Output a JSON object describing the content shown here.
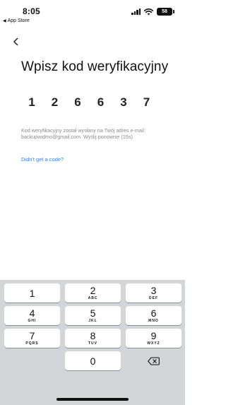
{
  "status_bar": {
    "time": "8:05",
    "back_app": "App Store",
    "battery": "58"
  },
  "header": {
    "back_icon": "chevron-left-icon"
  },
  "main": {
    "title": "Wpisz kod weryfikacyjny",
    "code_digits": [
      "1",
      "2",
      "6",
      "6",
      "3",
      "7"
    ],
    "info_line1": "Kod weryfikacyjny został wysłany na Twój adres e-mail:",
    "email": "backupwidmo@gmail.com",
    "resend_text": "Wyślij ponownie (15s)",
    "didnt_get_code": "Didn't get a code?"
  },
  "keypad": {
    "keys": [
      {
        "num": "1",
        "letters": ""
      },
      {
        "num": "2",
        "letters": "ABC"
      },
      {
        "num": "3",
        "letters": "DEF"
      },
      {
        "num": "4",
        "letters": "GHI"
      },
      {
        "num": "5",
        "letters": "JKL"
      },
      {
        "num": "6",
        "letters": "MNO"
      },
      {
        "num": "7",
        "letters": "PQRS"
      },
      {
        "num": "8",
        "letters": "TUV"
      },
      {
        "num": "9",
        "letters": "WXYZ"
      },
      {
        "num": "0",
        "letters": ""
      }
    ],
    "delete_icon": "backspace-icon"
  }
}
